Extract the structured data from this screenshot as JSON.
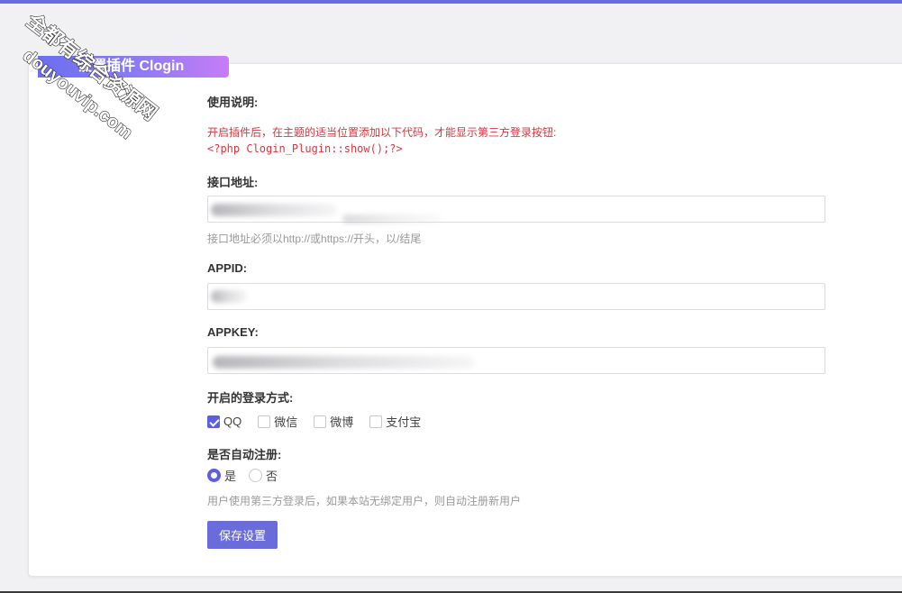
{
  "card_title": "设置插件 Clogin",
  "usage": {
    "heading": "使用说明:",
    "notice": "开启插件后，在主题的适当位置添加以下代码，才能显示第三方登录按钮:",
    "code": "<?php Clogin_Plugin::show();?>"
  },
  "api_url": {
    "label": "接口地址:",
    "value": "",
    "hint": "接口地址必须以http://或https://开头，以/结尾"
  },
  "appid": {
    "label": "APPID:",
    "value": ""
  },
  "appkey": {
    "label": "APPKEY:",
    "value": ""
  },
  "login_methods": {
    "label": "开启的登录方式:",
    "options": [
      {
        "label": "QQ",
        "checked": true
      },
      {
        "label": "微信",
        "checked": false
      },
      {
        "label": "微博",
        "checked": false
      },
      {
        "label": "支付宝",
        "checked": false
      }
    ]
  },
  "auto_register": {
    "label": "是否自动注册:",
    "options": [
      {
        "label": "是",
        "selected": true
      },
      {
        "label": "否",
        "selected": false
      }
    ],
    "hint": "用户使用第三方登录后，如果本站无绑定用户，则自动注册新用户"
  },
  "save_button": "保存设置",
  "watermark": {
    "line1": "全都有综合资源网",
    "line2": "douyouvip.com"
  },
  "colors": {
    "accent": "#6a6cdc",
    "notice_red": "#d9363e",
    "tab_gradient_start": "#6b6ff0",
    "tab_gradient_end": "#c77cf6"
  }
}
